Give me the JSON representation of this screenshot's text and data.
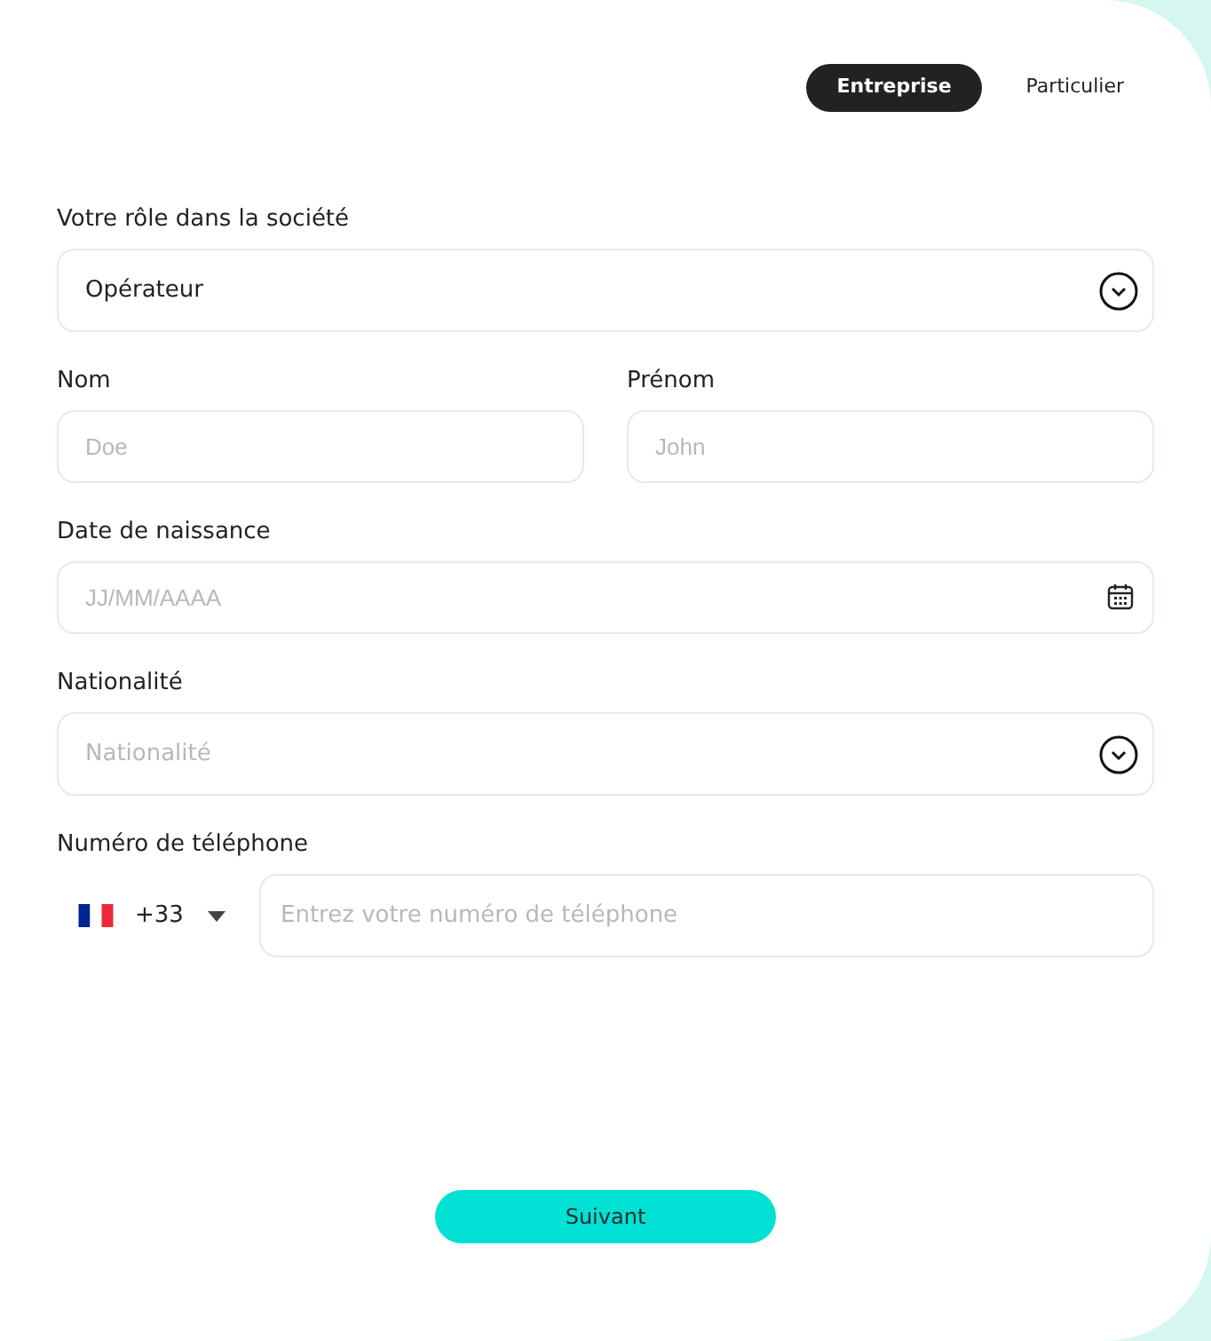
{
  "tabs": [
    {
      "label": "Entreprise",
      "selected": true
    },
    {
      "label": "Particulier",
      "selected": false
    }
  ],
  "rows": [
    [
      {
        "kind": "select",
        "label": "Votre rôle dans la société",
        "value": "Opérateur"
      }
    ],
    [
      {
        "kind": "text",
        "label": "Nom",
        "placeholder": "Doe"
      },
      {
        "kind": "text",
        "label": "Prénom",
        "placeholder": "John"
      }
    ],
    [
      {
        "kind": "date",
        "label": "Date de naissance",
        "placeholder": "JJ/MM/AAAA"
      }
    ],
    [
      {
        "kind": "select",
        "label": "Nationalité",
        "placeholder": "Nationalité"
      }
    ],
    [
      {
        "kind": "phone",
        "label": "Numéro de téléphone",
        "dial_code": "+33",
        "placeholder": "Entrez votre numéro de téléphone"
      }
    ]
  ],
  "submit": "Suivant"
}
